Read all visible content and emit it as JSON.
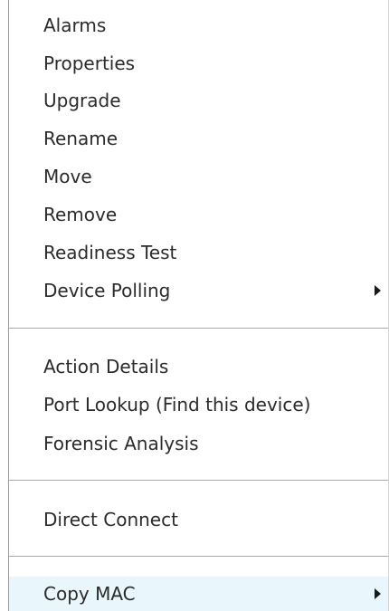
{
  "menu": {
    "items": [
      {
        "label": "Alarms"
      },
      {
        "label": "Properties"
      },
      {
        "label": "Upgrade"
      },
      {
        "label": "Rename"
      },
      {
        "label": "Move"
      },
      {
        "label": "Remove"
      },
      {
        "label": "Readiness Test"
      },
      {
        "label": "Device Polling",
        "submenu_icon": "submenu-arrow-icon"
      },
      {
        "label": "Action Details"
      },
      {
        "label": "Port Lookup (Find this device)"
      },
      {
        "label": "Forensic Analysis"
      },
      {
        "label": "Direct Connect"
      },
      {
        "label": "Copy MAC",
        "submenu_icon": "submenu-arrow-icon",
        "hover_color": "#e9f6fc"
      }
    ]
  }
}
